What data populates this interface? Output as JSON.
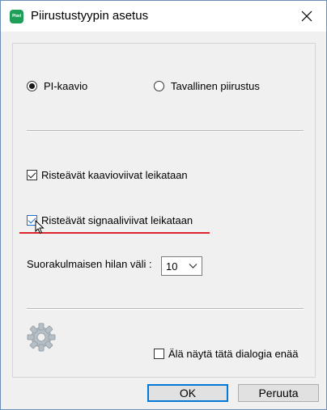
{
  "window": {
    "title": "Piirustustyypin asetus",
    "app_icon_text": "Pixel"
  },
  "drawing_type": {
    "options": [
      {
        "label": "PI-kaavio",
        "selected": true
      },
      {
        "label": "Tavallinen piirustus",
        "selected": false
      }
    ]
  },
  "options": {
    "cut_chart_lines": {
      "label": "Risteävät kaavioviivat leikataan",
      "checked": true
    },
    "cut_signal_lines": {
      "label": "Risteävät signaaliviivat leikataan",
      "checked": true
    }
  },
  "grid": {
    "label": "Suorakulmaisen hilan väli :",
    "value": "10"
  },
  "dont_show": {
    "label": "Älä näytä tätä dialogia enää",
    "checked": false
  },
  "buttons": {
    "ok": "OK",
    "cancel": "Peruuta"
  },
  "colors": {
    "accent": "#0078d7",
    "highlight_line": "#e0232a"
  }
}
